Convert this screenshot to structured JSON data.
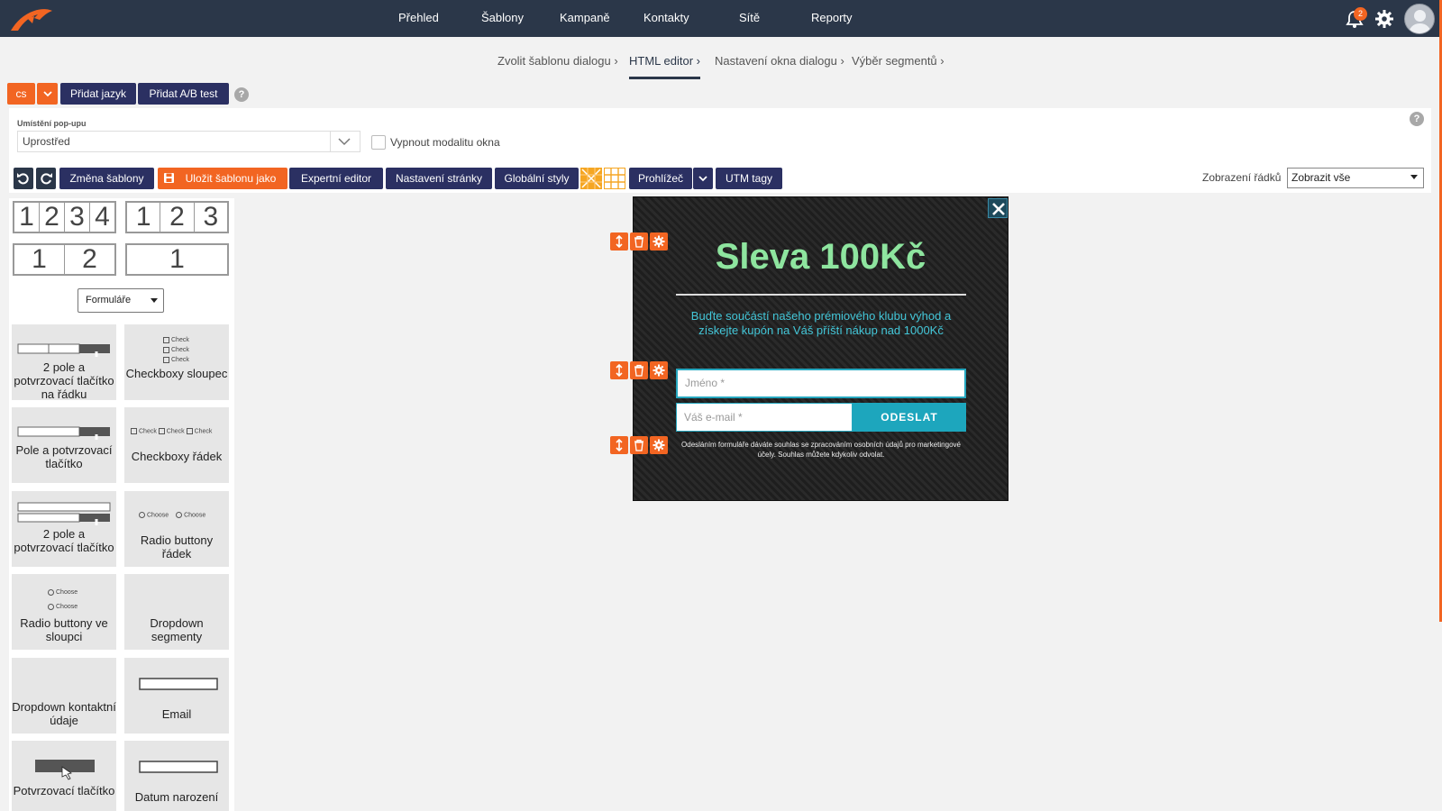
{
  "nav": {
    "items": [
      "Přehled",
      "Šablony",
      "Kampaně",
      "Kontakty",
      "Sítě",
      "Reporty"
    ],
    "notification_count": "2"
  },
  "breadcrumb": {
    "steps": [
      "Zvolit šablonu dialogu ›",
      "HTML editor ›",
      "Nastavení okna dialogu ›",
      "Výběr segmentů ›"
    ]
  },
  "lang_bar": {
    "lang": "cs",
    "add_language": "Přidat jazyk",
    "add_ab_test": "Přidat A/B test",
    "help": "?"
  },
  "placement": {
    "label": "Umístění pop-upu",
    "value": "Uprostřed",
    "modal_off_label": "Vypnout modalitu okna"
  },
  "toolbar": {
    "change_template": "Změna šablony",
    "save_as_template": "Uložit šablonu jako",
    "expert_editor": "Expertní editor",
    "page_settings": "Nastavení stránky",
    "global_styles": "Globální styly",
    "browser": "Prohlížeč",
    "utm_tags": "UTM tagy",
    "row_view_label": "Zobrazení řádků",
    "row_view_value": "Zobrazit vše"
  },
  "sidebar": {
    "layouts": [
      [
        "1",
        "2",
        "3",
        "4"
      ],
      [
        "1",
        "2",
        "3"
      ],
      [
        "1",
        "2"
      ],
      [
        "1"
      ]
    ],
    "category_select": "Formuláře",
    "blocks": [
      "2 pole a potvrzovací tlačítko na řádku",
      "Checkboxy sloupec",
      "Pole a potvrzovací tlačítko",
      "Checkboxy řádek",
      "2 pole a potvrzovací tlačítko",
      "Radio buttony řádek",
      "Radio buttony ve sloupci",
      "Dropdown segmenty",
      "Dropdown kontaktní údaje",
      "Email",
      "Potvrzovací tlačítko",
      "Datum narození"
    ],
    "mini_check": "Check",
    "mini_choose": "Choose"
  },
  "popup": {
    "title": "Sleva 100Kč",
    "subtitle": "Buďte součástí našeho prémiového klubu výhod a získejte kupón na Váš příští nákup nad 1000Kč",
    "name_placeholder": "Jméno *",
    "email_placeholder": "Váš e-mail *",
    "submit": "ODESLAT",
    "consent": "Odesláním formuláře dáváte souhlas se zpracováním osobních údajů pro marketingové účely. Souhlas můžete kdykoliv odvolat."
  },
  "colors": {
    "topbar": "#2b3749",
    "accent_orange": "#f26522",
    "button_dark": "#2b3062",
    "popup_title": "#8ee59f",
    "popup_subtitle": "#43c6d8",
    "submit": "#1da6bd"
  }
}
